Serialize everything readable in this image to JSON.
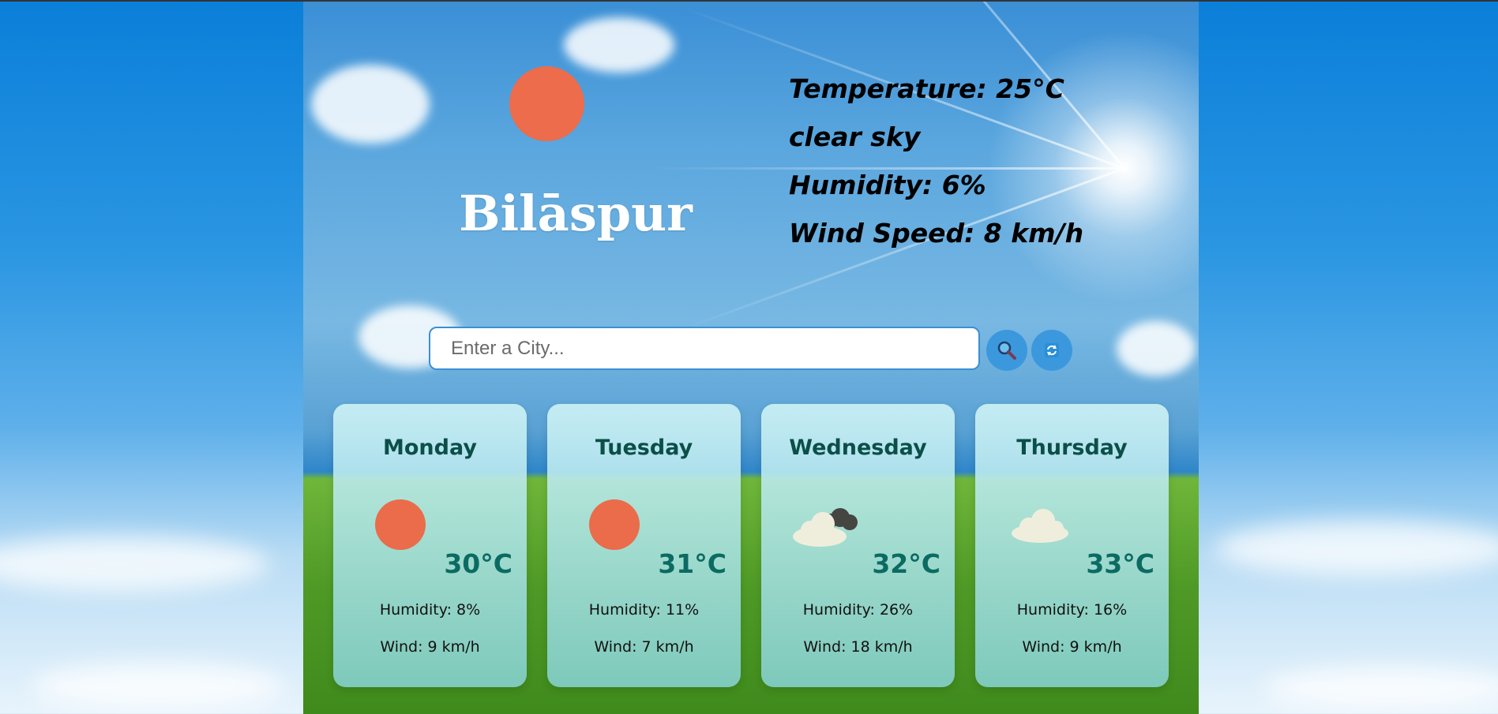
{
  "current": {
    "city": "Bilāspur",
    "temperature": "Temperature: 25°C",
    "condition": "clear sky",
    "humidity": "Humidity: 6%",
    "wind": "Wind Speed: 8 km/h",
    "icon": "sun-icon"
  },
  "search": {
    "placeholder": "Enter a City...",
    "value": ""
  },
  "buttons": {
    "search_icon": "magnifier-icon",
    "refresh_icon": "refresh-icon"
  },
  "forecast": [
    {
      "day": "Monday",
      "temp": "30°C",
      "humidity": "Humidity: 8%",
      "wind": "Wind: 9 km/h",
      "icon": "sun-icon"
    },
    {
      "day": "Tuesday",
      "temp": "31°C",
      "humidity": "Humidity: 11%",
      "wind": "Wind: 7 km/h",
      "icon": "sun-icon"
    },
    {
      "day": "Wednesday",
      "temp": "32°C",
      "humidity": "Humidity: 26%",
      "wind": "Wind: 18 km/h",
      "icon": "dark-cloud-icon"
    },
    {
      "day": "Thursday",
      "temp": "33°C",
      "humidity": "Humidity: 16%",
      "wind": "Wind: 9 km/h",
      "icon": "cloud-icon"
    }
  ],
  "colors": {
    "sun": "#ec6c4b",
    "card_text": "#0b4f48",
    "temp_text": "#0b6b62",
    "button": "#3b98dd"
  }
}
